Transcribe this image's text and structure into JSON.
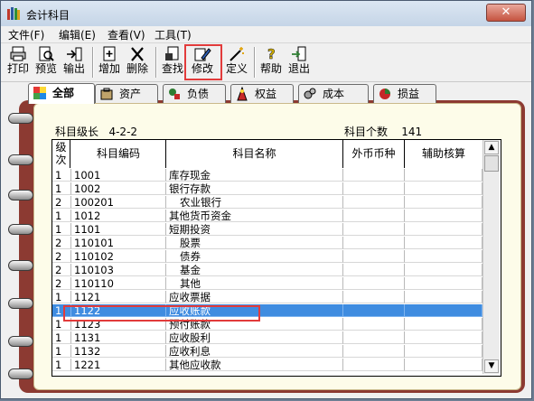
{
  "window": {
    "title": "会计科目",
    "close_label": "✕"
  },
  "menu": [
    "文件(F)",
    "编辑(E)",
    "查看(V)",
    "工具(T)"
  ],
  "toolbar": [
    {
      "id": "print",
      "label": "打印"
    },
    {
      "id": "preview",
      "label": "预览"
    },
    {
      "id": "export",
      "label": "输出"
    },
    {
      "id": "add",
      "label": "增加"
    },
    {
      "id": "delete",
      "label": "删除"
    },
    {
      "id": "find",
      "label": "查找"
    },
    {
      "id": "modify",
      "label": "修改"
    },
    {
      "id": "define",
      "label": "定义"
    },
    {
      "id": "help",
      "label": "帮助"
    },
    {
      "id": "exit",
      "label": "退出"
    }
  ],
  "tabs": [
    {
      "label": "全部",
      "active": true
    },
    {
      "label": "资产",
      "active": false
    },
    {
      "label": "负债",
      "active": false
    },
    {
      "label": "权益",
      "active": false
    },
    {
      "label": "成本",
      "active": false
    },
    {
      "label": "损益",
      "active": false
    }
  ],
  "info": {
    "level_label": "科目级长",
    "level_value": "4-2-2",
    "count_label": "科目个数",
    "count_value": "141"
  },
  "columns": {
    "level": "级次",
    "code": "科目编码",
    "name": "科目名称",
    "currency": "外币币种",
    "aux": "辅助核算"
  },
  "rows": [
    {
      "level": "1",
      "code": "1001",
      "name": "库存现金"
    },
    {
      "level": "1",
      "code": "1002",
      "name": "银行存款"
    },
    {
      "level": "2",
      "code": "100201",
      "name": "农业银行",
      "indent": true
    },
    {
      "level": "1",
      "code": "1012",
      "name": "其他货币资金"
    },
    {
      "level": "1",
      "code": "1101",
      "name": "短期投资"
    },
    {
      "level": "2",
      "code": "110101",
      "name": "股票",
      "indent": true
    },
    {
      "level": "2",
      "code": "110102",
      "name": "债券",
      "indent": true
    },
    {
      "level": "2",
      "code": "110103",
      "name": "基金",
      "indent": true
    },
    {
      "level": "2",
      "code": "110110",
      "name": "其他",
      "indent": true
    },
    {
      "level": "1",
      "code": "1121",
      "name": "应收票据"
    },
    {
      "level": "1",
      "code": "1122",
      "name": "应收账款",
      "selected": true
    },
    {
      "level": "1",
      "code": "1123",
      "name": "预付账款"
    },
    {
      "level": "1",
      "code": "1131",
      "name": "应收股利"
    },
    {
      "level": "1",
      "code": "1132",
      "name": "应收利息"
    },
    {
      "level": "1",
      "code": "1221",
      "name": "其他应收款"
    }
  ]
}
